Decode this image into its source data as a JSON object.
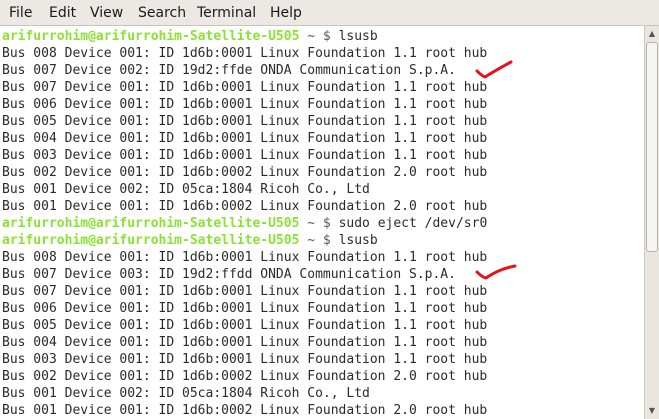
{
  "menubar": {
    "items": [
      "File",
      "Edit",
      "View",
      "Search",
      "Terminal",
      "Help"
    ]
  },
  "terminal": {
    "prompt_user": "arifurrohim@arifurrohim-Satellite-U505",
    "prompt_sep": " ~ $ ",
    "lines": [
      {
        "type": "prompt",
        "cmd": "lsusb"
      },
      {
        "type": "out",
        "text": "Bus 008 Device 001: ID 1d6b:0001 Linux Foundation 1.1 root hub"
      },
      {
        "type": "out",
        "text": "Bus 007 Device 002: ID 19d2:ffde ONDA Communication S.p.A."
      },
      {
        "type": "out",
        "text": "Bus 007 Device 001: ID 1d6b:0001 Linux Foundation 1.1 root hub"
      },
      {
        "type": "out",
        "text": "Bus 006 Device 001: ID 1d6b:0001 Linux Foundation 1.1 root hub"
      },
      {
        "type": "out",
        "text": "Bus 005 Device 001: ID 1d6b:0001 Linux Foundation 1.1 root hub"
      },
      {
        "type": "out",
        "text": "Bus 004 Device 001: ID 1d6b:0001 Linux Foundation 1.1 root hub"
      },
      {
        "type": "out",
        "text": "Bus 003 Device 001: ID 1d6b:0001 Linux Foundation 1.1 root hub"
      },
      {
        "type": "out",
        "text": "Bus 002 Device 001: ID 1d6b:0002 Linux Foundation 2.0 root hub"
      },
      {
        "type": "out",
        "text": "Bus 001 Device 002: ID 05ca:1804 Ricoh Co., Ltd"
      },
      {
        "type": "out",
        "text": "Bus 001 Device 001: ID 1d6b:0002 Linux Foundation 2.0 root hub"
      },
      {
        "type": "prompt",
        "cmd": "sudo eject /dev/sr0"
      },
      {
        "type": "prompt",
        "cmd": "lsusb"
      },
      {
        "type": "out",
        "text": "Bus 008 Device 001: ID 1d6b:0001 Linux Foundation 1.1 root hub"
      },
      {
        "type": "out",
        "text": "Bus 007 Device 003: ID 19d2:ffdd ONDA Communication S.p.A."
      },
      {
        "type": "out",
        "text": "Bus 007 Device 001: ID 1d6b:0001 Linux Foundation 1.1 root hub"
      },
      {
        "type": "out",
        "text": "Bus 006 Device 001: ID 1d6b:0001 Linux Foundation 1.1 root hub"
      },
      {
        "type": "out",
        "text": "Bus 005 Device 001: ID 1d6b:0001 Linux Foundation 1.1 root hub"
      },
      {
        "type": "out",
        "text": "Bus 004 Device 001: ID 1d6b:0001 Linux Foundation 1.1 root hub"
      },
      {
        "type": "out",
        "text": "Bus 003 Device 001: ID 1d6b:0001 Linux Foundation 1.1 root hub"
      },
      {
        "type": "out",
        "text": "Bus 002 Device 001: ID 1d6b:0002 Linux Foundation 2.0 root hub"
      },
      {
        "type": "out",
        "text": "Bus 001 Device 002: ID 05ca:1804 Ricoh Co., Ltd"
      },
      {
        "type": "out",
        "text": "Bus 001 Device 001: ID 1d6b:0002 Linux Foundation 2.0 root hub"
      }
    ]
  },
  "colors": {
    "prompt_user": "#8ae234",
    "text": "#2b2b2b",
    "annotation": "#e8101a"
  },
  "icons": {
    "annotation_mark": "red-checkmark-icon",
    "scroll_up": "scroll-up-arrow-icon",
    "scroll_down": "scroll-down-arrow-icon"
  }
}
